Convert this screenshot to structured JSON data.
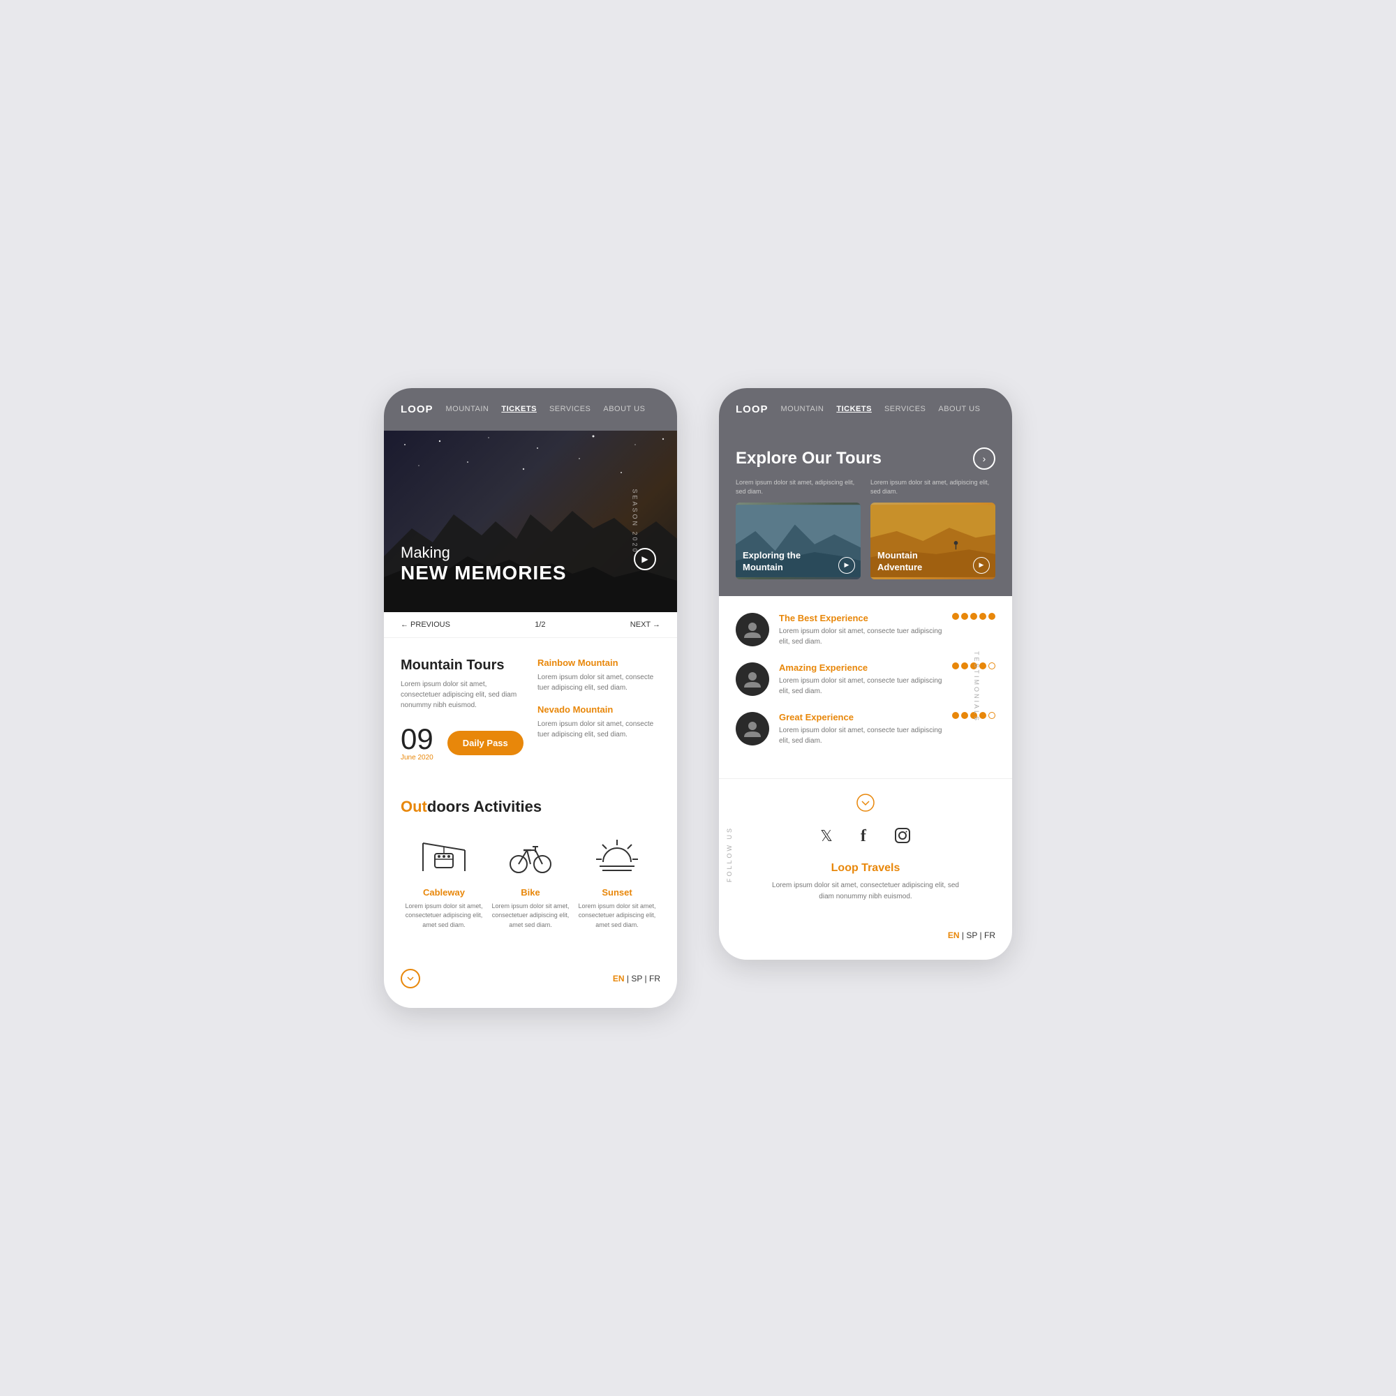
{
  "phone1": {
    "nav": {
      "logo": "LOOP",
      "items": [
        "MOUNTAIN",
        "TICKETS",
        "SERVICES",
        "ABOUT US"
      ],
      "active": "TICKETS"
    },
    "hero": {
      "making": "Making",
      "main": "NEW MEMORIES",
      "season": "SEASON 2020"
    },
    "controls": {
      "prev": "← PREVIOUS",
      "count": "1/2",
      "next": "NEXT →"
    },
    "mountain_tours": {
      "title": "Mountain Tours",
      "desc": "Lorem ipsum dolor sit amet, consectetuer adipiscing elit, sed diam nonummy nibh euismod."
    },
    "date": {
      "num": "09",
      "sub": "June 2020",
      "btn": "Daily Pass"
    },
    "rainbow": {
      "title": "Rainbow Mountain",
      "desc": "Lorem ipsum dolor sit amet, consecte tuer adipiscing elit, sed diam."
    },
    "nevado": {
      "title": "Nevado Mountain",
      "desc": "Lorem ipsum dolor sit amet, consecte tuer adipiscing elit, sed diam."
    },
    "outdoor": {
      "title_out": "Out",
      "title_rest": "doors Activities"
    },
    "activities": [
      {
        "label": "Cableway",
        "desc": "Lorem ipsum dolor sit amet, consectetuer adipiscing elit, amet sed diam."
      },
      {
        "label": "Bike",
        "desc": "Lorem ipsum dolor sit amet, consectetuer adipiscing elit, amet sed diam."
      },
      {
        "label": "Sunset",
        "desc": "Lorem ipsum dolor sit amet, consectetuer adipiscing elit, amet sed diam."
      }
    ],
    "footer": {
      "lang_active": "EN",
      "lang_other1": "SP",
      "lang_other2": "FR"
    }
  },
  "phone2": {
    "nav": {
      "logo": "LOOP",
      "items": [
        "MOUNTAIN",
        "TICKETS",
        "SERVICES",
        "ABOUT US"
      ],
      "active": "TICKETS"
    },
    "tours": {
      "title": "Explore Our Tours",
      "card1_desc": "Lorem ipsum dolor sit amet, adipiscing elit, sed diam.",
      "card1_label1": "Exploring the",
      "card1_label2": "Mountain",
      "card2_desc": "Lorem ipsum dolor sit amet, adipiscing elit, sed diam.",
      "card2_label1": "Mountain",
      "card2_label2": "Adventure"
    },
    "testimonials": [
      {
        "name": "The Best Experience",
        "desc": "Lorem ipsum dolor sit amet, consecte tuer adipiscing elit, sed diam.",
        "stars": 5
      },
      {
        "name": "Amazing Experience",
        "desc": "Lorem ipsum dolor sit amet, consecte tuer adipiscing elit, sed diam.",
        "stars": 4
      },
      {
        "name": "Great Experience",
        "desc": "Lorem ipsum dolor sit amet, consecte tuer adipiscing elit, sed diam.",
        "stars": 4
      }
    ],
    "side_label": "TESTIMONIALS",
    "follow_label": "FOLLOW US",
    "social": [
      "twitter",
      "facebook",
      "instagram"
    ],
    "brand": "Loop Travels",
    "brand_desc": "Lorem ipsum dolor sit amet, consectetuer adipiscing elit, sed diam nonummy nibh euismod.",
    "footer": {
      "lang_active": "EN",
      "lang_other1": "SP",
      "lang_other2": "FR"
    }
  }
}
